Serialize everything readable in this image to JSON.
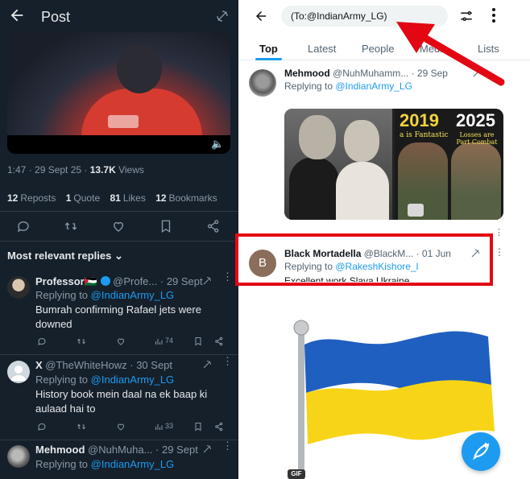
{
  "left": {
    "header": {
      "title": "Post"
    },
    "post_meta": {
      "time": "1:47 · 29 Sept 25 · ",
      "views_count": "13.7K",
      "views_label": " Views"
    },
    "stats": [
      {
        "count": "12",
        "label": "Reposts"
      },
      {
        "count": "1",
        "label": "Quote"
      },
      {
        "count": "81",
        "label": "Likes"
      },
      {
        "count": "12",
        "label": "Bookmarks"
      }
    ],
    "replies_filter": "Most relevant replies ⌄",
    "replies": [
      {
        "name": "Professor🇵🇸",
        "handle": "@Profe...",
        "date": "· 29 Sept",
        "replying_prefix": "Replying to ",
        "replying_to": "@IndianArmy_LG",
        "text": "Bumrah confirming Rafael jets were downed",
        "views": "74"
      },
      {
        "name": "X",
        "handle": "@TheWhiteHowz",
        "date": "· 30 Sept",
        "replying_prefix": "Replying to ",
        "replying_to": "@IndianArmy_LG",
        "text": "History book mein daal na ek baap ki aulaad hai to",
        "views": "33"
      },
      {
        "name": "Mehmood",
        "handle": "@NuhMuha...",
        "date": "· 29 Sept",
        "replying_prefix": "Replying to ",
        "replying_to": "@IndianArmy_LG"
      }
    ]
  },
  "right": {
    "search": {
      "value": "(To:@IndianArmy_LG)"
    },
    "tabs": [
      "Top",
      "Latest",
      "People",
      "Media",
      "Lists"
    ],
    "tweets": [
      {
        "name": "Mehmood",
        "handle": "@NuhMuhamm...",
        "date": "· 29 Sep",
        "replying_prefix": "Replying to ",
        "replying_to": "@IndianArmy_LG",
        "meme": {
          "year_left": "2019",
          "year_right": "2025",
          "caption_left": "a is Fantastic",
          "caption_right": "Losses are Part Combat"
        }
      },
      {
        "avatar_letter": "B",
        "name": "Black Mortadella",
        "handle": "@BlackM...",
        "date": "· 01 Jun",
        "replying_prefix": "Replying to ",
        "replying_to": "@RakeshKishore_l",
        "text": "Excellent work Slava Ukraine"
      }
    ],
    "gif_badge": "GIF"
  },
  "colors": {
    "accent": "#1d9bf0",
    "annotation_red": "#e30613",
    "flag_blue": "#1f5fbf",
    "flag_yellow": "#f7d417"
  }
}
